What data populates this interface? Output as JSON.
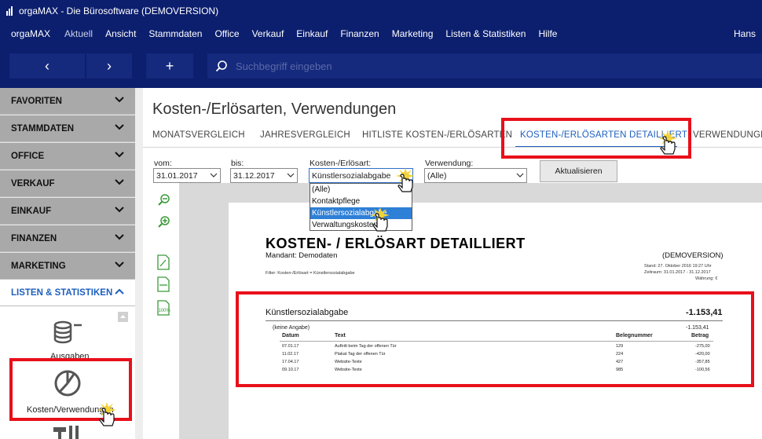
{
  "window": {
    "title": "orgaMAX - Die Bürosoftware (DEMOVERSION)"
  },
  "menu": {
    "brand": "orgaMAX",
    "items": [
      "Aktuell",
      "Ansicht",
      "Stammdaten",
      "Office",
      "Verkauf",
      "Einkauf",
      "Finanzen",
      "Marketing",
      "Listen & Statistiken",
      "Hilfe"
    ],
    "user": "Hans"
  },
  "toolbar": {
    "back": "‹",
    "forward": "›",
    "add": "+",
    "search_placeholder": "Suchbegriff eingeben"
  },
  "sidebar": {
    "items": [
      "FAVORITEN",
      "STAMMDATEN",
      "OFFICE",
      "VERKAUF",
      "EINKAUF",
      "FINANZEN",
      "MARKETING",
      "LISTEN & STATISTIKEN"
    ],
    "sub_items": [
      "Ausgaben",
      "Kosten/Verwendungen"
    ]
  },
  "page": {
    "title": "Kosten-/Erlösarten, Verwendungen",
    "tabs": [
      "MONATSVERGLEICH",
      "JAHRESVERGLEICH",
      "HITLISTE KOSTEN-/ERLÖSARTEN",
      "KOSTEN-/ERLÖSARTEN DETAILLIERT",
      "VERWENDUNGEN"
    ],
    "active_tab": "KOSTEN-/ERLÖSARTEN DETAILLIERT"
  },
  "filters": {
    "vom_label": "vom:",
    "vom_value": "31.01.2017",
    "bis_label": "bis:",
    "bis_value": "31.12.2017",
    "kostenart_label": "Kosten-/Erlösart:",
    "kostenart_value": "Künstlersozialabgabe",
    "verwendung_label": "Verwendung:",
    "verwendung_value": "(Alle)",
    "refresh_button": "Aktualisieren",
    "kostenart_options": [
      "(Alle)",
      "Kontaktpflege",
      "Künstlersozialabgabe",
      "Verwaltungskosten"
    ]
  },
  "report": {
    "title": "KOSTEN- / ERLÖSART DETAILLIERT",
    "mandant": "Mandant:  Demodaten",
    "demoversion": "(DEMOVERSION)",
    "filter": "Filter: Kosten-/Erlösart = Künstlersozialabgabe",
    "stand": "Stand:   27. Oktober 2016 19:27 Uhr",
    "zeitraum": "Zeitraum: 31.01.2017 - 31.12.2017",
    "waehrung": "Währung: €",
    "group_name": "Künstlersozialabgabe",
    "group_total": "-1.153,41",
    "sub_group": "(keine Angabe)",
    "sub_total": "-1.153,41",
    "columns": [
      "Datum",
      "Text",
      "Belegnummer",
      "Betrag"
    ],
    "rows": [
      {
        "datum": "07.01.17",
        "text": "Auftritt beim Tag der offenen Tür",
        "beleg": "129",
        "betrag": "-275,00"
      },
      {
        "datum": "11.02.17",
        "text": "Plakat Tag der offenen Tür",
        "beleg": "224",
        "betrag": "-420,00"
      },
      {
        "datum": "17.04.17",
        "text": "Website-Texte",
        "beleg": "427",
        "betrag": "-357,85"
      },
      {
        "datum": "09.10.17",
        "text": "Website-Texte",
        "beleg": "985",
        "betrag": "-100,56"
      }
    ]
  },
  "colors": {
    "navy": "#0c1f6e",
    "accent": "#1e5fbf",
    "highlight": "#e8101a"
  }
}
